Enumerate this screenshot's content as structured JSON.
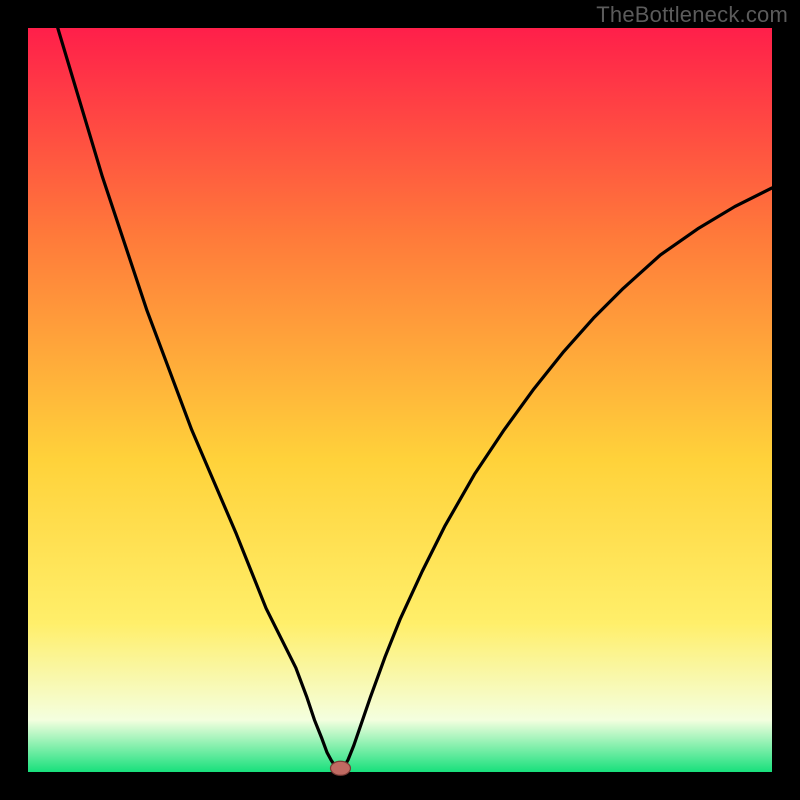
{
  "watermark": "TheBottleneck.com",
  "colors": {
    "gradient_top": "#ff1f4a",
    "gradient_mid1": "#ff7a3a",
    "gradient_mid2": "#ffd23a",
    "gradient_mid3": "#ffef6a",
    "gradient_bottom_pale": "#f4ffdf",
    "gradient_bottom": "#18e07c",
    "curve": "#000000",
    "marker_fill": "#c06a62",
    "marker_stroke": "#7a3b36",
    "frame": "#000000"
  },
  "chart_data": {
    "type": "line",
    "title": "",
    "xlabel": "",
    "ylabel": "",
    "x_range": [
      0,
      100
    ],
    "y_range": [
      0,
      100
    ],
    "curve_points_xy": [
      [
        4,
        100
      ],
      [
        7,
        90
      ],
      [
        10,
        80
      ],
      [
        13,
        71
      ],
      [
        16,
        62
      ],
      [
        19,
        54
      ],
      [
        22,
        46
      ],
      [
        25,
        39
      ],
      [
        28,
        32
      ],
      [
        30,
        27
      ],
      [
        32,
        22
      ],
      [
        34,
        18
      ],
      [
        36,
        14
      ],
      [
        37.5,
        10
      ],
      [
        38.5,
        7
      ],
      [
        39.5,
        4.5
      ],
      [
        40.2,
        2.6
      ],
      [
        40.8,
        1.5
      ],
      [
        41.3,
        0.8
      ],
      [
        41.7,
        0.4
      ],
      [
        42,
        0.3
      ],
      [
        42.4,
        0.6
      ],
      [
        43,
        1.6
      ],
      [
        43.8,
        3.6
      ],
      [
        44.8,
        6.5
      ],
      [
        46,
        10
      ],
      [
        48,
        15.5
      ],
      [
        50,
        20.5
      ],
      [
        53,
        27
      ],
      [
        56,
        33
      ],
      [
        60,
        40
      ],
      [
        64,
        46
      ],
      [
        68,
        51.5
      ],
      [
        72,
        56.5
      ],
      [
        76,
        61
      ],
      [
        80,
        65
      ],
      [
        85,
        69.5
      ],
      [
        90,
        73
      ],
      [
        95,
        76
      ],
      [
        100,
        78.5
      ]
    ],
    "marker_xy": [
      42,
      0.5
    ],
    "description": "V-shaped bottleneck curve reaching minimum near x≈42 on a red→green vertical gradient background (lower = better)."
  }
}
